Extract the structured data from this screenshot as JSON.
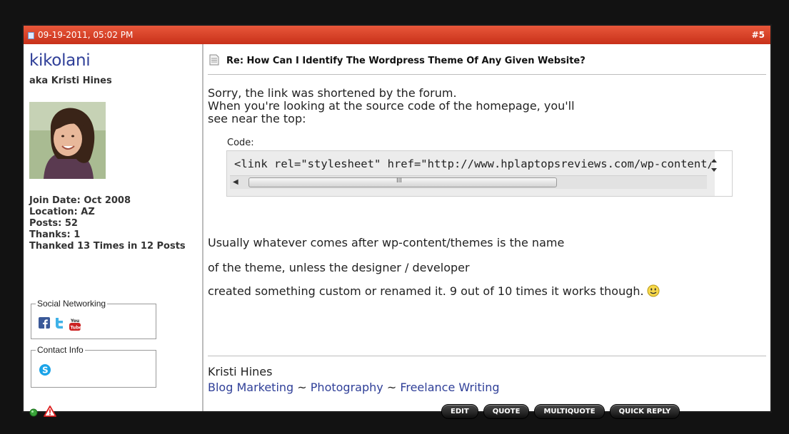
{
  "post": {
    "date": "09-19-2011, 05:02 PM",
    "number": "#5"
  },
  "user": {
    "name": "kikolani",
    "title": "aka Kristi Hines",
    "join_date": "Join Date: Oct 2008",
    "location": "Location: AZ",
    "posts": "Posts: 52",
    "thanks": "Thanks: 1",
    "thanked": "Thanked 13 Times in 12 Posts",
    "social_legend": "Social Networking",
    "contact_legend": "Contact Info",
    "social_icons": [
      "facebook-icon",
      "twitter-icon",
      "youtube-icon"
    ],
    "contact_icons": [
      "skype-icon"
    ],
    "status_icons": [
      "online-status-icon",
      "report-post-icon"
    ]
  },
  "message": {
    "title": "Re: How Can I Identify The Wordpress Theme Of Any Given Website?",
    "intro_line1": "Sorry, the link was shortened by the forum.",
    "intro_line2": "When you're looking at the source code of the homepage, you'll",
    "intro_line3": "see near the top:",
    "code_label": "Code:",
    "code_text": "<link rel=\"stylesheet\" href=\"http://www.hplaptopsreviews.com/wp-content/themes/",
    "para1": "Usually whatever comes after wp-content/themes is the name",
    "para2": "of the theme, unless the designer / developer",
    "para3": "created something custom or renamed it. 9 out of 10 times it works though.",
    "smiley": "smile-emoticon-icon"
  },
  "signature": {
    "name": "Kristi Hines",
    "link1": "Blog Marketing",
    "sep1": " ~ ",
    "link2": "Photography",
    "sep2": " ~ ",
    "link3": "Freelance Writing"
  },
  "buttons": {
    "edit": "EDIT",
    "quote": "QUOTE",
    "multiquote": "MULTIQUOTE",
    "quick_reply": "QUICK REPLY"
  },
  "colors": {
    "header": "#d84025",
    "username": "#2f3f98",
    "link": "#2f3f98"
  }
}
